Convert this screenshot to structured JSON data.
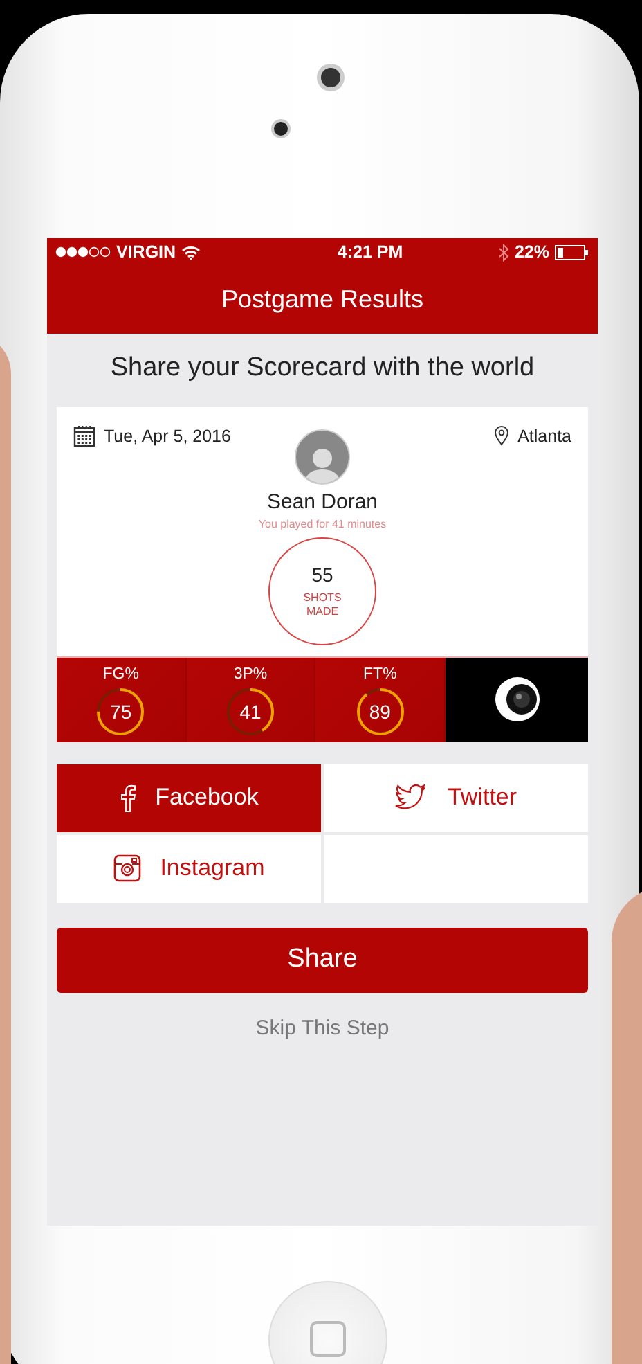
{
  "status_bar": {
    "carrier": "VIRGIN",
    "time": "4:21 PM",
    "battery": "22%"
  },
  "nav": {
    "title": "Postgame Results"
  },
  "heading": "Share your Scorecard with the world",
  "scorecard": {
    "date": "Tue, Apr 5, 2016",
    "location": "Atlanta",
    "player": "Sean Doran",
    "subtitle": "You played for 41 minutes",
    "shots": "55",
    "shots_label": "SHOTS\nMADE",
    "stats": [
      {
        "label": "FG%",
        "value": "75",
        "level": 0.75
      },
      {
        "label": "3P%",
        "value": "41",
        "level": 0.41
      },
      {
        "label": "FT%",
        "value": "89",
        "level": 0.89
      }
    ]
  },
  "share_options": [
    {
      "kind": "facebook",
      "label": "Facebook",
      "selected": true
    },
    {
      "kind": "twitter",
      "label": "Twitter",
      "selected": false
    },
    {
      "kind": "instagram",
      "label": "Instagram",
      "selected": false
    }
  ],
  "share_button": "Share",
  "skip": "Skip This Step"
}
